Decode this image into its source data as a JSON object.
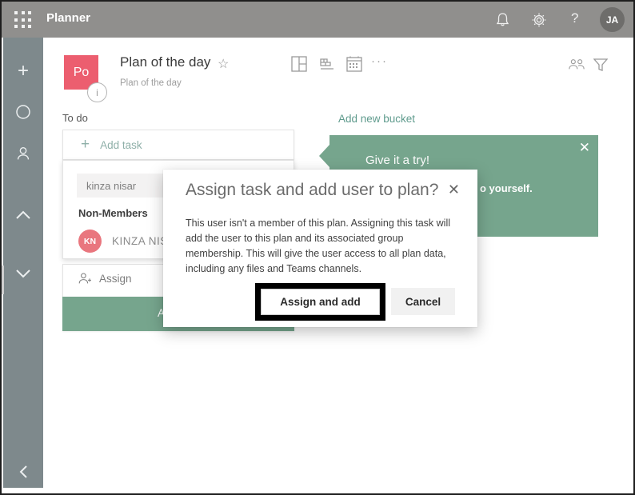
{
  "topbar": {
    "app_title": "Planner",
    "help_label": "?",
    "avatar_initials": "JA"
  },
  "plan": {
    "tile_initials": "Po",
    "info_glyph": "i",
    "title": "Plan of the day",
    "star_glyph": "☆",
    "subtitle": "Plan of the day",
    "more_glyph": "···"
  },
  "board": {
    "bucket_title": "To do",
    "add_task_plus": "+",
    "add_task_label": "Add task",
    "add_new_bucket_label": "Add new bucket"
  },
  "flyout": {
    "search_value": "kinza nisar",
    "section_label": "Non-Members",
    "member_initials": "KN",
    "member_name": "KINZA NIS",
    "assign_label": "Assign",
    "add_button_visible_text": "A"
  },
  "callout": {
    "title": "Give it a try!",
    "close_glyph": "✕",
    "visible_fragment": "o yourself."
  },
  "dialog": {
    "title": "Assign task and add user to plan?",
    "close_glyph": "✕",
    "body": "This user isn't a member of this plan. Assigning this task will add the user to this plan and its associated group membership. This will give the user access to all plan data, including any files and Teams channels.",
    "confirm_label": "Assign and add",
    "cancel_label": "Cancel"
  },
  "colors": {
    "topbar_bg": "#908f8d",
    "sidenav_bg": "#7e898c",
    "accent_green": "#76a58d",
    "teal_link": "#5f9b8d",
    "plan_tile": "#ec5e6f",
    "member_avatar": "#e9767e",
    "highlight_border": "#000000"
  }
}
